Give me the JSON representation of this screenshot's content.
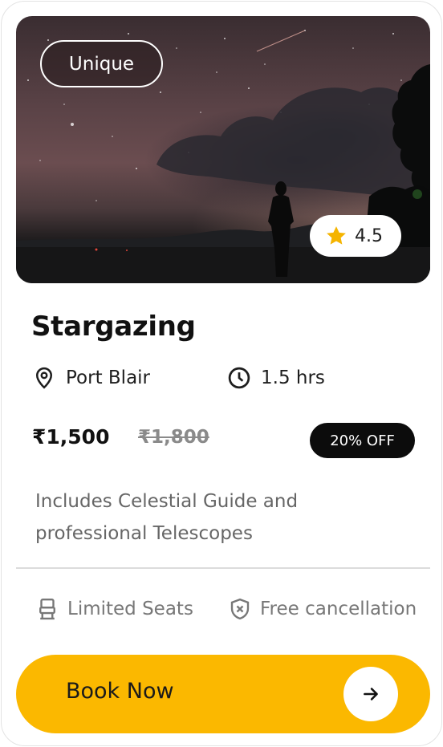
{
  "card": {
    "tag": "Unique",
    "rating": "4.5",
    "title": "Stargazing",
    "location": "Port Blair",
    "duration": "1.5 hrs",
    "price": "₹1,500",
    "original_price": "₹1,800",
    "discount": "20% OFF",
    "description": "Includes Celestial Guide and professional Telescopes",
    "features": [
      {
        "label": "Limited Seats",
        "icon": "seat-icon"
      },
      {
        "label": "Free cancellation",
        "icon": "shield-x-icon"
      }
    ],
    "cta": {
      "label": "Book Now",
      "icon": "arrow-right-icon"
    }
  },
  "colors": {
    "accent": "#fbb800",
    "star": "#f5b400",
    "badge": "#0c0c0c",
    "muted_text": "#666666"
  }
}
